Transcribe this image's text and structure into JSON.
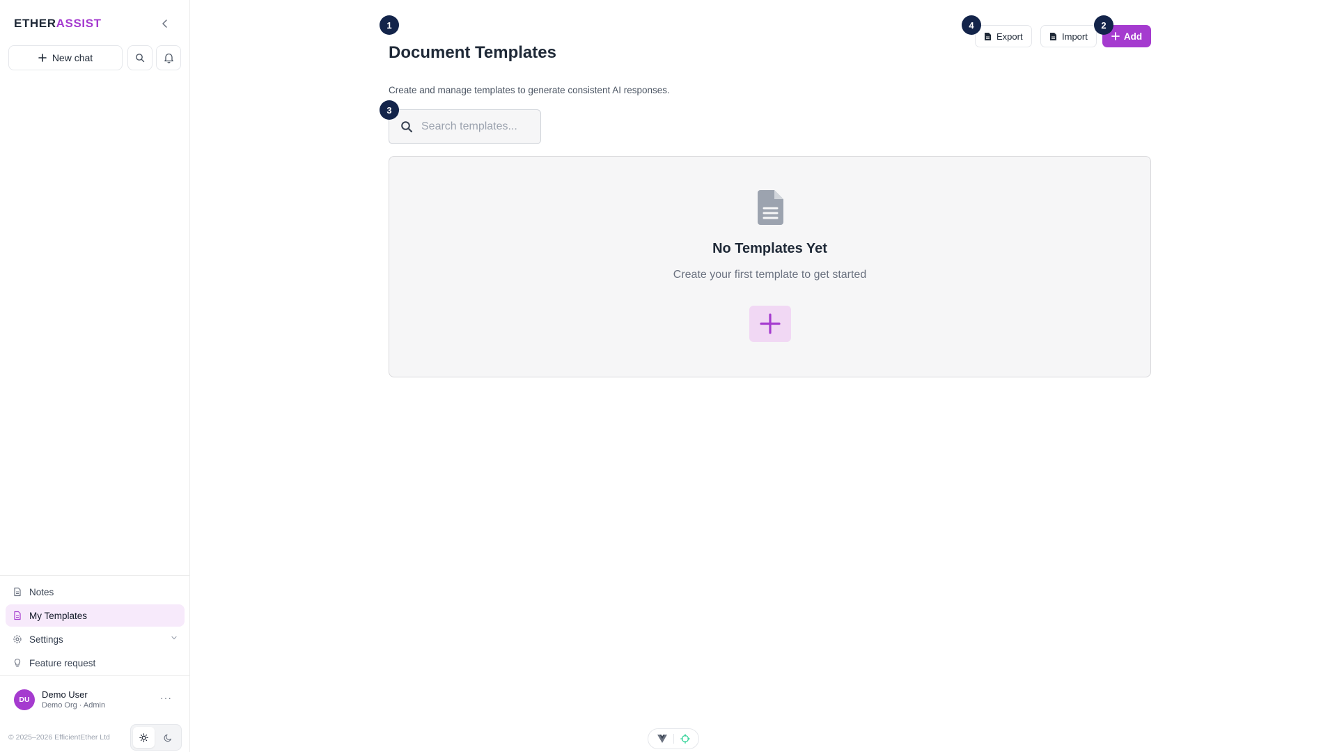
{
  "brand": {
    "part1": "ETHER",
    "part2": "ASSIST"
  },
  "sidebar": {
    "new_chat_label": "New chat",
    "nav_items": [
      {
        "label": "Notes",
        "icon": "note-icon"
      },
      {
        "label": "My Templates",
        "icon": "template-icon",
        "active": true
      },
      {
        "label": "Settings",
        "icon": "gear-icon",
        "expandable": true
      },
      {
        "label": "Feature request",
        "icon": "lightbulb-icon"
      }
    ],
    "user": {
      "initials": "DU",
      "name": "Demo User",
      "meta": "Demo Org · Admin",
      "more": "···"
    },
    "copyright": "© 2025–2026 EfficientEther Ltd",
    "theme": {
      "selected": "light"
    }
  },
  "main": {
    "title": "Document Templates",
    "subtitle": "Create and manage templates to generate consistent AI responses.",
    "buttons": {
      "export": "Export",
      "import": "Import",
      "add": "Add"
    },
    "search": {
      "placeholder": "Search templates..."
    },
    "empty_state": {
      "title": "No Templates Yet",
      "subtitle": "Create your first template to get started"
    },
    "markers": [
      "1",
      "2",
      "3",
      "4"
    ]
  },
  "colors": {
    "accent": "#a53bcf",
    "marker": "#13244a",
    "accent_soft": "#f1d8f4"
  }
}
